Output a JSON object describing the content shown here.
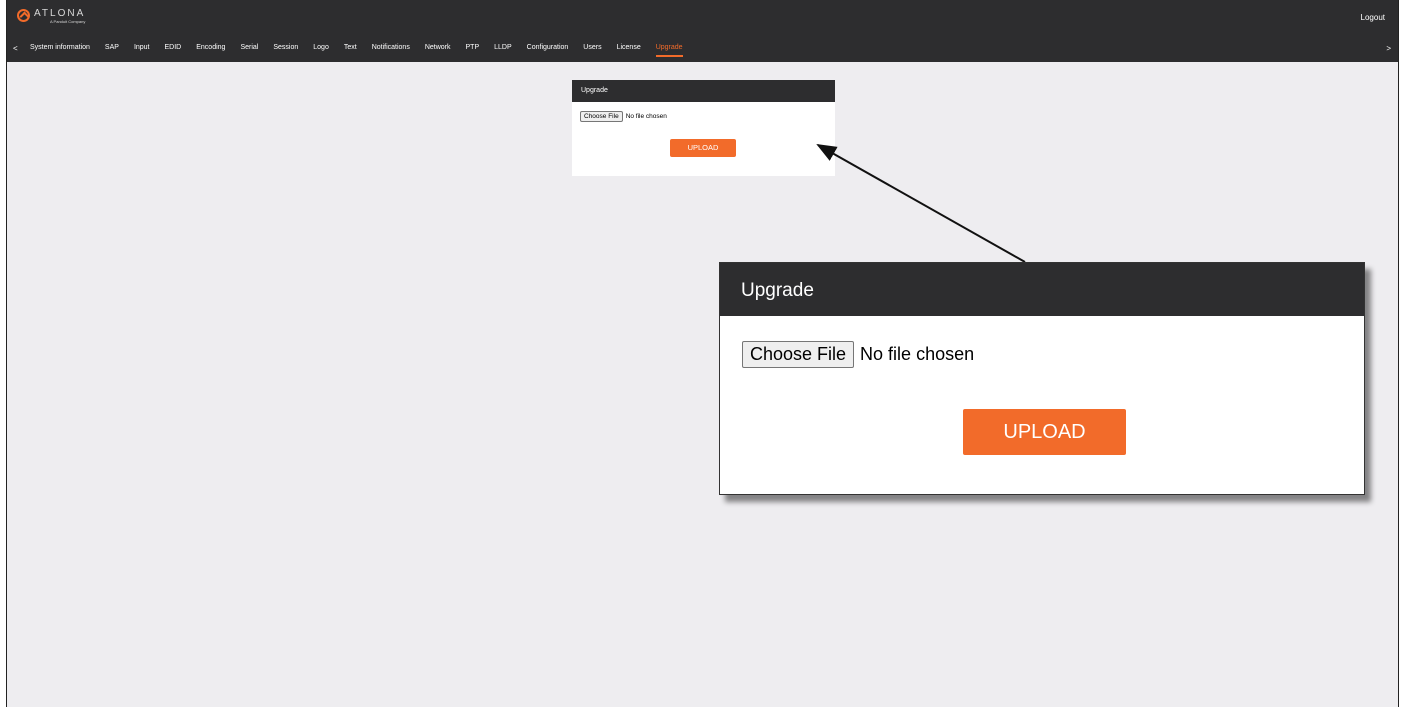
{
  "brand": {
    "logo_text": "ATLONA",
    "logo_subtext": "A Panduit Company"
  },
  "header": {
    "logout_label": "Logout"
  },
  "nav": {
    "prev_label": "<",
    "next_label": ">",
    "items": [
      {
        "label": "System information"
      },
      {
        "label": "SAP"
      },
      {
        "label": "Input"
      },
      {
        "label": "EDID"
      },
      {
        "label": "Encoding"
      },
      {
        "label": "Serial"
      },
      {
        "label": "Session"
      },
      {
        "label": "Logo"
      },
      {
        "label": "Text"
      },
      {
        "label": "Notifications"
      },
      {
        "label": "Network"
      },
      {
        "label": "PTP"
      },
      {
        "label": "LLDP"
      },
      {
        "label": "Configuration"
      },
      {
        "label": "Users"
      },
      {
        "label": "License"
      },
      {
        "label": "Upgrade",
        "active": true
      }
    ]
  },
  "upgrade_panel": {
    "title": "Upgrade",
    "choose_file_label": "Choose File",
    "file_status": "No file chosen",
    "upload_label": "UPLOAD"
  },
  "callout": {
    "title": "Upgrade",
    "choose_file_label": "Choose File",
    "file_status": "No file chosen",
    "upload_label": "UPLOAD"
  },
  "colors": {
    "accent": "#f26b2a",
    "header_bg": "#2d2d2f",
    "page_bg": "#eeedf0"
  }
}
